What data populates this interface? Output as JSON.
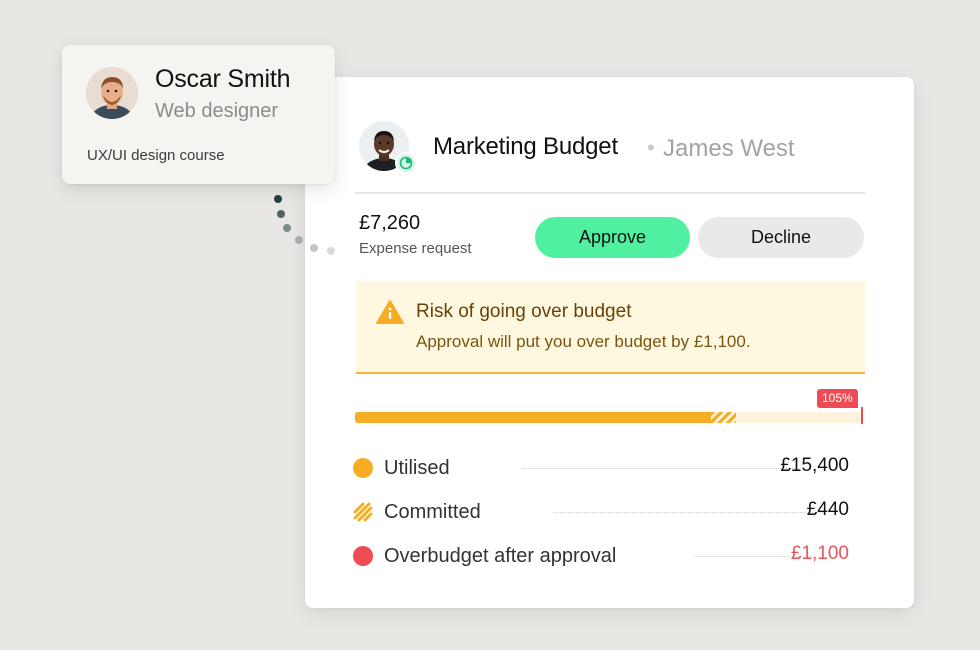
{
  "profile": {
    "name": "Oscar Smith",
    "role": "Web designer",
    "course": "UX/UI design course"
  },
  "budget": {
    "title": "Marketing Budget",
    "separator": "•",
    "owner": "James West",
    "expense_amount": "£7,260",
    "expense_label": "Expense request",
    "approve_label": "Approve",
    "decline_label": "Decline",
    "warning": {
      "icon": "warning-triangle-icon",
      "title": "Risk of going over budget",
      "text": "Approval will put you over budget by £1,100."
    },
    "progress": {
      "percent_label": "105%",
      "utilised_fraction": 0.7,
      "committed_fraction": 0.05
    },
    "legend": [
      {
        "label": "Utilised",
        "value": "£15,400",
        "marker": "solid-dot",
        "color": "#f6ad24"
      },
      {
        "label": "Committed",
        "value": "£440",
        "marker": "striped",
        "color": "#f6ad24"
      },
      {
        "label": "Overbudget after approval",
        "value": "£1,100",
        "marker": "solid-dot",
        "color": "#ef4b55"
      }
    ]
  },
  "colors": {
    "accent_green": "#4ff0a0",
    "warning_bg": "#fff8e1",
    "warning_border": "#f6b53a",
    "danger": "#ef4b55",
    "amber": "#f6ad24"
  }
}
